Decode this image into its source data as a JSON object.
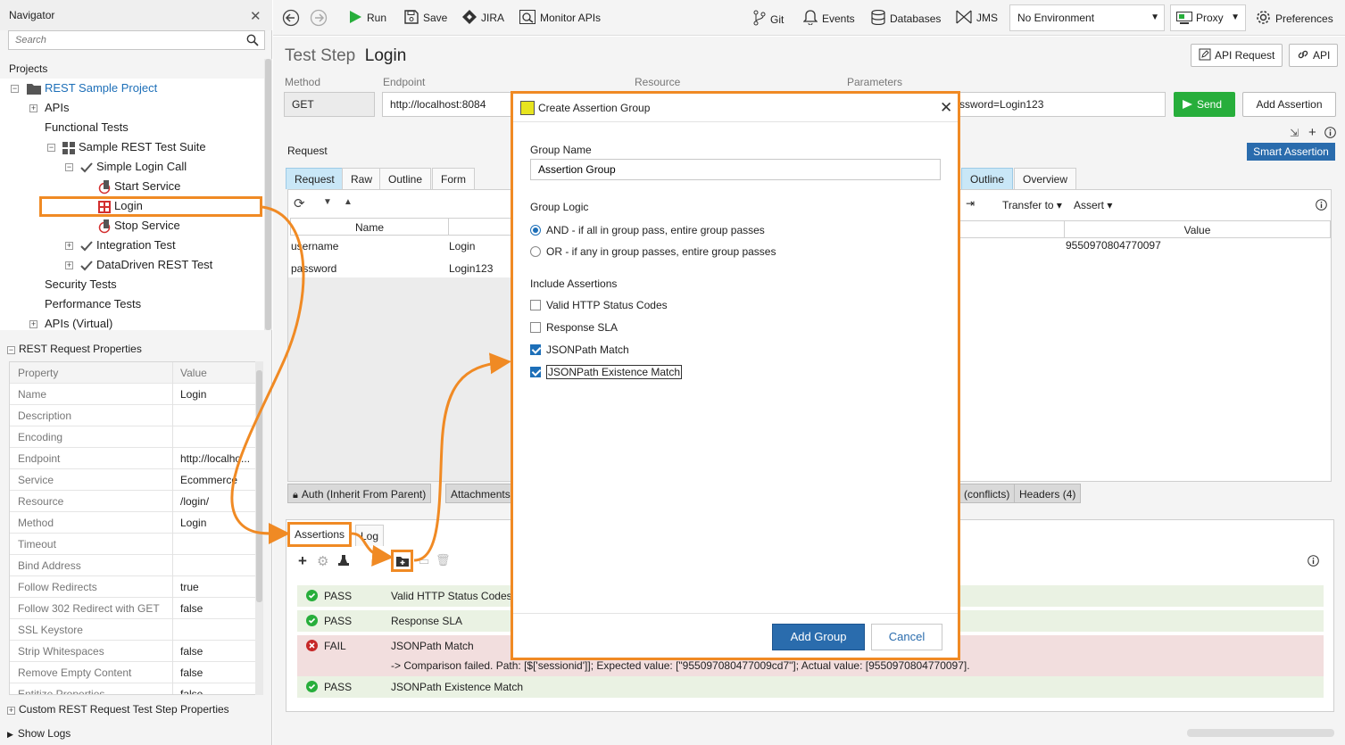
{
  "navigator": {
    "title": "Navigator",
    "search_placeholder": "Search",
    "projects_label": "Projects",
    "tree": [
      {
        "label": "REST Sample Project"
      },
      {
        "label": "APIs"
      },
      {
        "label": "Functional Tests"
      },
      {
        "label": "Sample REST Test Suite"
      },
      {
        "label": "Simple Login Call"
      },
      {
        "label": "Start Service"
      },
      {
        "label": "Login"
      },
      {
        "label": "Stop Service"
      },
      {
        "label": "Integration Test"
      },
      {
        "label": "DataDriven REST Test"
      },
      {
        "label": "Security Tests"
      },
      {
        "label": "Performance Tests"
      },
      {
        "label": "APIs (Virtual)"
      }
    ],
    "props_title": "REST Request Properties",
    "props_headers": [
      "Property",
      "Value"
    ],
    "props": [
      {
        "k": "Name",
        "v": "Login"
      },
      {
        "k": "Description",
        "v": ""
      },
      {
        "k": "Encoding",
        "v": ""
      },
      {
        "k": "Endpoint",
        "v": "http://localho..."
      },
      {
        "k": "Service",
        "v": "Ecommerce"
      },
      {
        "k": "Resource",
        "v": "/login/"
      },
      {
        "k": "Method",
        "v": "Login"
      },
      {
        "k": "Timeout",
        "v": ""
      },
      {
        "k": "Bind Address",
        "v": ""
      },
      {
        "k": "Follow Redirects",
        "v": "true"
      },
      {
        "k": "Follow 302 Redirect with GET",
        "v": "false"
      },
      {
        "k": "SSL Keystore",
        "v": ""
      },
      {
        "k": "Strip Whitespaces",
        "v": "false"
      },
      {
        "k": "Remove Empty Content",
        "v": "false"
      },
      {
        "k": "Entitize Properties",
        "v": "false"
      }
    ],
    "custom_props": "Custom REST Request Test Step Properties",
    "show_logs": "Show Logs"
  },
  "toolbar": {
    "run": "Run",
    "save": "Save",
    "jira": "JIRA",
    "monitor": "Monitor APIs",
    "git": "Git",
    "events": "Events",
    "databases": "Databases",
    "jms": "JMS",
    "environment": "No Environment",
    "proxy": "Proxy",
    "preferences": "Preferences"
  },
  "step": {
    "prefix": "Test Step",
    "name": "Login",
    "api_request_btn": "API Request",
    "api_btn": "API",
    "method_label": "Method",
    "endpoint_label": "Endpoint",
    "resource_label": "Resource",
    "parameters_label": "Parameters",
    "method": "GET",
    "endpoint": "http://localhost:8084",
    "parameters": "ssword=Login123",
    "send": "Send",
    "add_assertion": "Add Assertion",
    "request_label": "Request",
    "smart_assertion": "Smart Assertion",
    "req_tabs": [
      "Request",
      "Raw",
      "Outline",
      "Form"
    ],
    "resp_tabs": [
      "Outline",
      "Overview"
    ],
    "transfer_to": "Transfer to",
    "assert": "Assert",
    "col_name": "Name",
    "col_value": "Value",
    "params": [
      {
        "name": "username",
        "value": "Login"
      },
      {
        "name": "password",
        "value": "Login123"
      }
    ],
    "resp_value": "9550970804770097",
    "bottom_tabs": {
      "auth": "Auth (Inherit From Parent)",
      "attach": "Attachments",
      "conflicts": "(conflicts)",
      "headers": "Headers (4)"
    }
  },
  "assertions": {
    "tab": "Assertions",
    "log_tab": "Log",
    "rows": [
      {
        "status": "PASS",
        "name": "Valid HTTP Status Codes"
      },
      {
        "status": "PASS",
        "name": "Response SLA"
      },
      {
        "status": "FAIL",
        "name": "JSONPath Match",
        "detail": "-> Comparison failed. Path: [$['sessionid']]; Expected value: [\"955097080477009cd7\"]; Actual value: [9550970804770097]."
      },
      {
        "status": "PASS",
        "name": "JSONPath Existence Match"
      }
    ]
  },
  "dialog": {
    "title": "Create Assertion Group",
    "group_name_label": "Group Name",
    "group_name_value": "Assertion Group",
    "group_logic_label": "Group Logic",
    "logic_and": "AND - if all in group pass, entire group passes",
    "logic_or": "OR - if any in group passes, entire group passes",
    "include_label": "Include Assertions",
    "include": [
      {
        "label": "Valid HTTP Status Codes",
        "checked": false
      },
      {
        "label": "Response SLA",
        "checked": false
      },
      {
        "label": "JSONPath Match",
        "checked": true
      },
      {
        "label": "JSONPath Existence Match",
        "checked": true
      }
    ],
    "add_group": "Add Group",
    "cancel": "Cancel"
  },
  "colors": {
    "accent": "#f08a24",
    "primary": "#2a6cad",
    "pass": "#27ae3b",
    "fail": "#c62828"
  }
}
